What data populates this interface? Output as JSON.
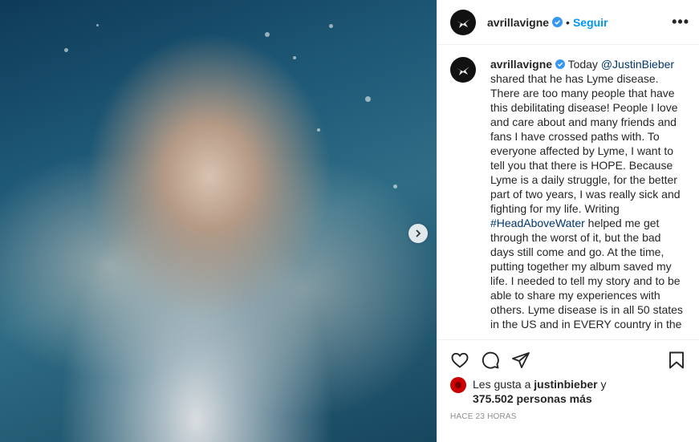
{
  "account": {
    "username": "avrillavigne",
    "follow_label": "Seguir",
    "more_label": "•••"
  },
  "caption": {
    "username": "avrillavigne",
    "pre_mention": " Today ",
    "mention": "@JustinBieber",
    "part1": " shared that he has Lyme disease. There are too many people that have this debilitating disease! People I love and care about and many friends and fans I have crossed paths with. To everyone affected by Lyme, I want to tell you that there is HOPE. Because Lyme is a daily struggle, for the better part of two years, I was really sick and fighting for my life. Writing ",
    "hashtag": "#HeadAboveWater",
    "part2": " helped me get through the worst of it, but the bad days still come and go. At the time, putting together my album saved my life. I needed to tell my story and to be able to share my experiences with others. Lyme disease is in all 50 states in the US and in EVERY country in the"
  },
  "likes": {
    "prefix": "Les gusta a ",
    "liker": "justinbieber",
    "connector": " y",
    "count": "375.502 personas más"
  },
  "timestamp": "HACE 23 HORAS",
  "icons": {
    "like": "heart-icon",
    "comment": "comment-icon",
    "share": "share-icon",
    "save": "bookmark-icon",
    "next": "chevron-right-icon",
    "verified": "verified-badge-icon"
  },
  "colors": {
    "link": "#00376b",
    "follow": "#0095f6",
    "meta": "#8e8e8e"
  }
}
